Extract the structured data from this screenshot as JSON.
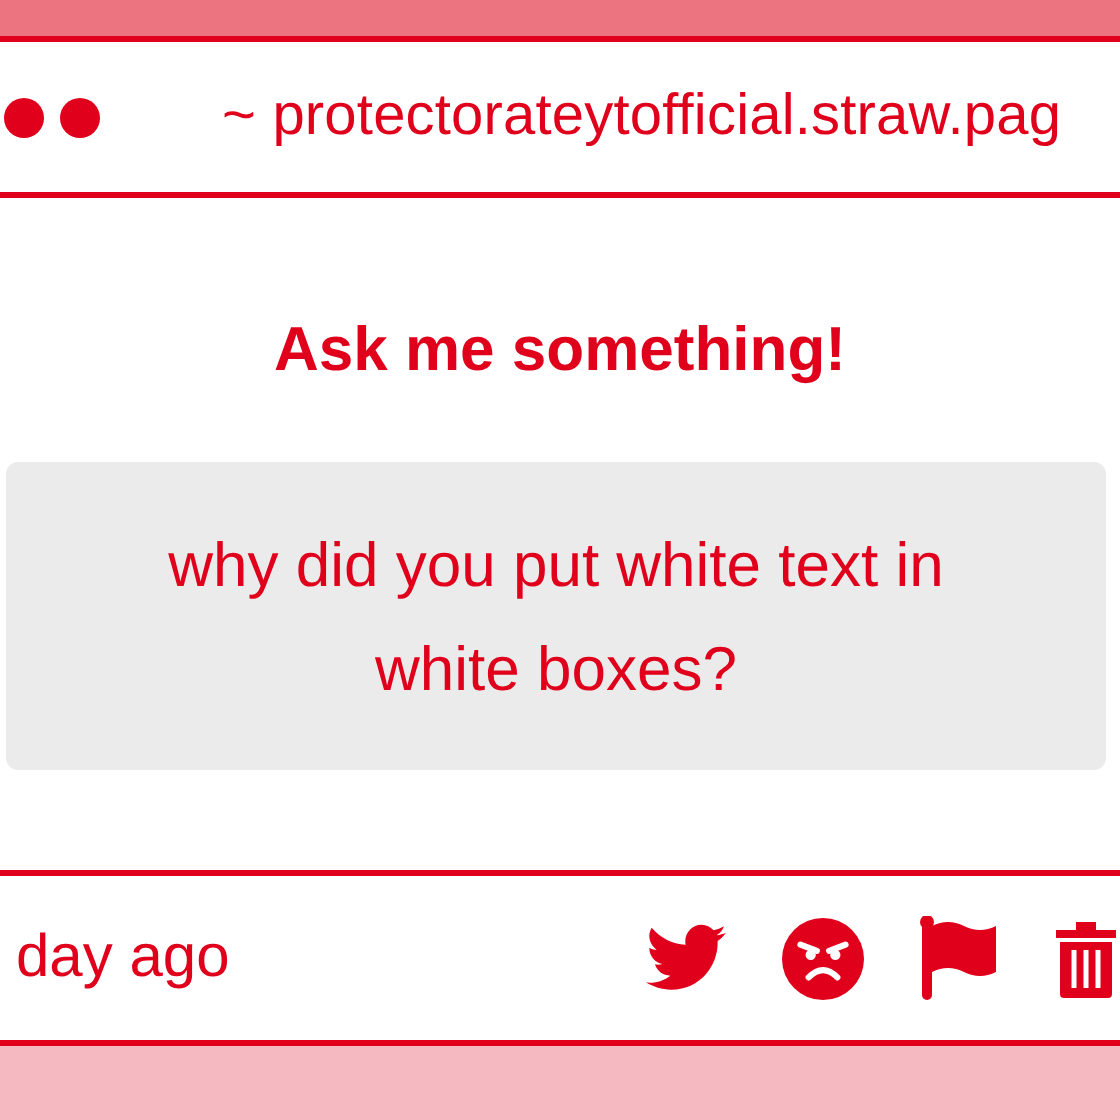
{
  "window": {
    "url": "~ protectorateytofficial.straw.pag"
  },
  "heading": "Ask me something!",
  "question": "why did you put white text in white boxes?",
  "footer": {
    "time": "day ago",
    "actions": [
      {
        "kind": "bird"
      },
      {
        "kind": "angry"
      },
      {
        "kind": "flag"
      },
      {
        "kind": "trash"
      }
    ]
  }
}
